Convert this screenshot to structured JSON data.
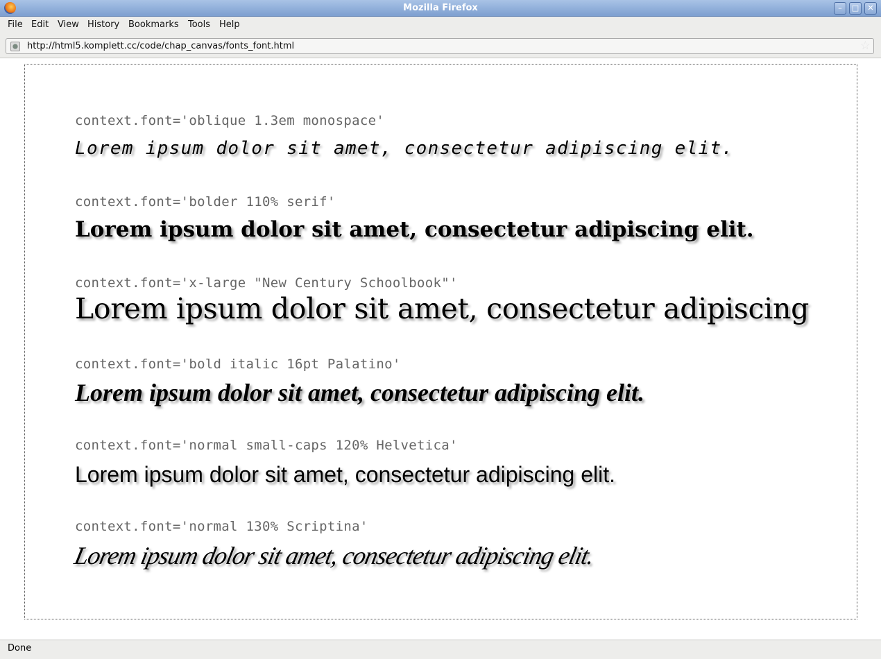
{
  "window": {
    "title": "Mozilla Firefox"
  },
  "menu": [
    "File",
    "Edit",
    "View",
    "History",
    "Bookmarks",
    "Tools",
    "Help"
  ],
  "url": "http://html5.komplett.cc/code/chap_canvas/fonts_font.html",
  "samples": [
    {
      "label": "context.font='oblique 1.3em monospace'",
      "text": "Lorem ipsum dolor sit amet, consectetur adipiscing elit."
    },
    {
      "label": "context.font='bolder 110% serif'",
      "text": "Lorem ipsum dolor sit amet, consectetur adipiscing elit."
    },
    {
      "label": "context.font='x-large \"New Century Schoolbook\"'",
      "text": "Lorem ipsum dolor sit amet, consectetur adipiscing"
    },
    {
      "label": "context.font='bold italic 16pt Palatino'",
      "text": "Lorem ipsum dolor sit amet, consectetur adipiscing elit."
    },
    {
      "label": "context.font='normal small-caps 120% Helvetica'",
      "text": "Lorem ipsum dolor sit amet, consectetur adipiscing elit."
    },
    {
      "label": "context.font='normal 130% Scriptina'",
      "text": "Lorem ipsum dolor sit amet, consectetur adipiscing elit."
    }
  ],
  "status": "Done"
}
